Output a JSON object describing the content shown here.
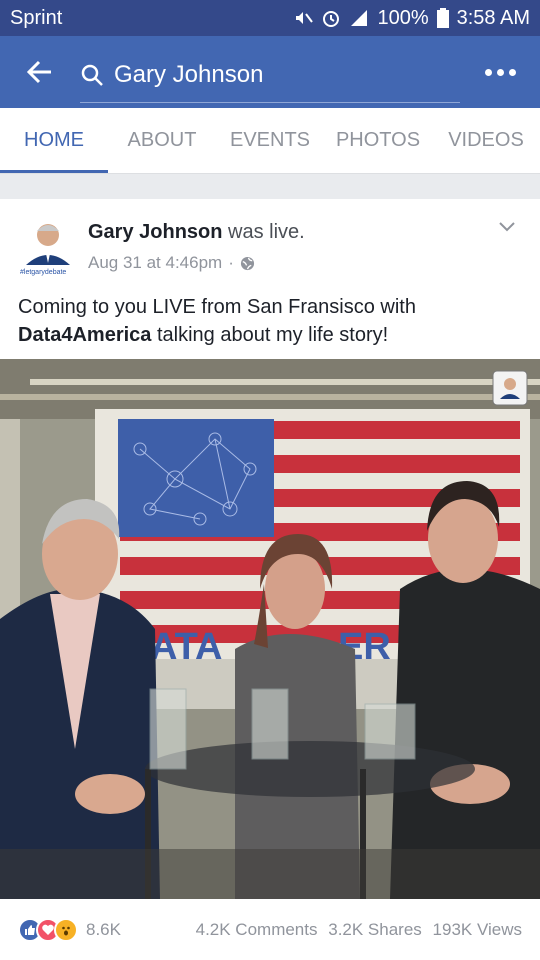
{
  "status_bar": {
    "carrier": "Sprint",
    "battery": "100%",
    "time": "3:58 AM"
  },
  "app_bar": {
    "search_text": "Gary Johnson"
  },
  "tabs": [
    {
      "label": "HOME",
      "active": true
    },
    {
      "label": "ABOUT",
      "active": false
    },
    {
      "label": "EVENTS",
      "active": false
    },
    {
      "label": "PHOTOS",
      "active": false
    },
    {
      "label": "VIDEOS",
      "active": false
    }
  ],
  "post": {
    "author": "Gary Johnson",
    "action": "was live.",
    "date": "Aug 31 at 4:46pm",
    "privacy_icon": "globe-icon",
    "avatar_caption": "#letgarydebate",
    "text_before": "Coming to you LIVE from San Fransisco with ",
    "text_bold": "Data4America",
    "text_after": " talking about my life story!",
    "video_banner_text": "ATA",
    "video_banner_text_2": "ER"
  },
  "footer": {
    "reaction_count": "8.6K",
    "comments": "4.2K Comments",
    "shares": "3.2K Shares",
    "views": "193K Views"
  },
  "colors": {
    "brand": "#4267b2",
    "status": "#34498a",
    "flag_red": "#c8313c",
    "flag_blue": "#3e5fa9"
  }
}
